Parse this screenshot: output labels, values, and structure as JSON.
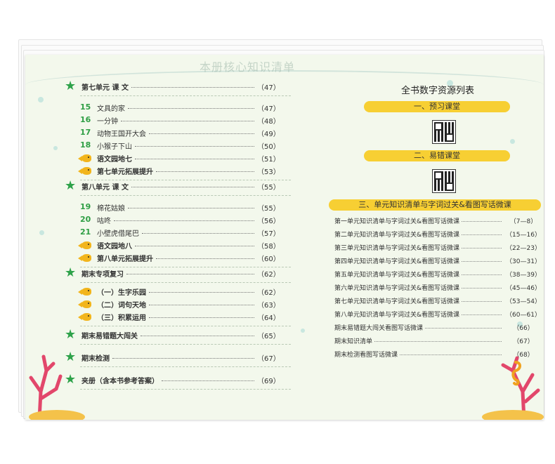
{
  "header": {
    "bg_title": "本册核心知识清单"
  },
  "toc": [
    {
      "type": "unit",
      "label": "第七单元 课 文",
      "page": "（47）"
    },
    {
      "type": "lesson",
      "num": "15",
      "label": "文具的家",
      "page": "（47）"
    },
    {
      "type": "lesson",
      "num": "16",
      "label": "一分钟",
      "page": "（48）"
    },
    {
      "type": "lesson",
      "num": "17",
      "label": "动物王国开大会",
      "page": "（49）"
    },
    {
      "type": "lesson",
      "num": "18",
      "label": "小猴子下山",
      "page": "（50）"
    },
    {
      "type": "fish",
      "label": "语文园地七",
      "page": "（51）"
    },
    {
      "type": "fish",
      "label": "第七单元拓展提升",
      "page": "（53）"
    },
    {
      "type": "unit",
      "label": "第八单元 课 文",
      "page": "（55）"
    },
    {
      "type": "lesson",
      "num": "19",
      "label": "棉花姑娘",
      "page": "（55）"
    },
    {
      "type": "lesson",
      "num": "20",
      "label": "咕咚",
      "page": "（56）"
    },
    {
      "type": "lesson",
      "num": "21",
      "label": "小壁虎借尾巴",
      "page": "（57）"
    },
    {
      "type": "fish",
      "label": "语文园地八",
      "page": "（58）"
    },
    {
      "type": "fish",
      "label": "第八单元拓展提升",
      "page": "（60）"
    },
    {
      "type": "unit",
      "label": "期末专项复习",
      "page": "（62）"
    },
    {
      "type": "fish",
      "label": "（一）生字乐园",
      "page": "（62）"
    },
    {
      "type": "fish",
      "label": "（二）词句天地",
      "page": "（63）"
    },
    {
      "type": "fish",
      "label": "（三）积累运用",
      "page": "（64）"
    },
    {
      "type": "unit",
      "label": "期末易错题大闯关",
      "page": "（65）"
    },
    {
      "type": "unit",
      "label": "期末检测",
      "page": "（67）"
    },
    {
      "type": "unit",
      "label": "夹册（含本书参考答案）",
      "page": "（69）"
    }
  ],
  "resources": {
    "title": "全书数字资源列表",
    "banner1": "一、预习课堂",
    "banner2": "二、易错课堂",
    "banner3": "三、单元知识清单与字词过关&看图写话微课",
    "rows": [
      {
        "label": "第一单元知识清单与字词过关&看图写话微课",
        "page": "（7—8）"
      },
      {
        "label": "第二单元知识清单与字词过关&看图写话微课",
        "page": "（15—16）"
      },
      {
        "label": "第三单元知识清单与字词过关&看图写话微课",
        "page": "（22—23）"
      },
      {
        "label": "第四单元知识清单与字词过关&看图写话微课",
        "page": "（30—31）"
      },
      {
        "label": "第五单元知识清单与字词过关&看图写话微课",
        "page": "（38—39）"
      },
      {
        "label": "第六单元知识清单与字词过关&看图写话微课",
        "page": "（45—46）"
      },
      {
        "label": "第七单元知识清单与字词过关&看图写话微课",
        "page": "（53—54）"
      },
      {
        "label": "第八单元知识清单与字词过关&看图写话微课",
        "page": "（60—61）"
      },
      {
        "label": "期末易错题大闯关看图写话微课",
        "page": "（66）"
      },
      {
        "label": "期末知识清单",
        "page": "（67）"
      },
      {
        "label": "期末检测看图写话微课",
        "page": "（68）"
      }
    ]
  },
  "colors": {
    "star": "#2ea24a",
    "fish": "#f2b51c",
    "banner": "#f7cf33",
    "lesson_num": "#2e9e44"
  },
  "icons": [
    "starfish-icon",
    "fish-icon",
    "qr-code-icon",
    "coral-icon",
    "seahorse-icon"
  ]
}
